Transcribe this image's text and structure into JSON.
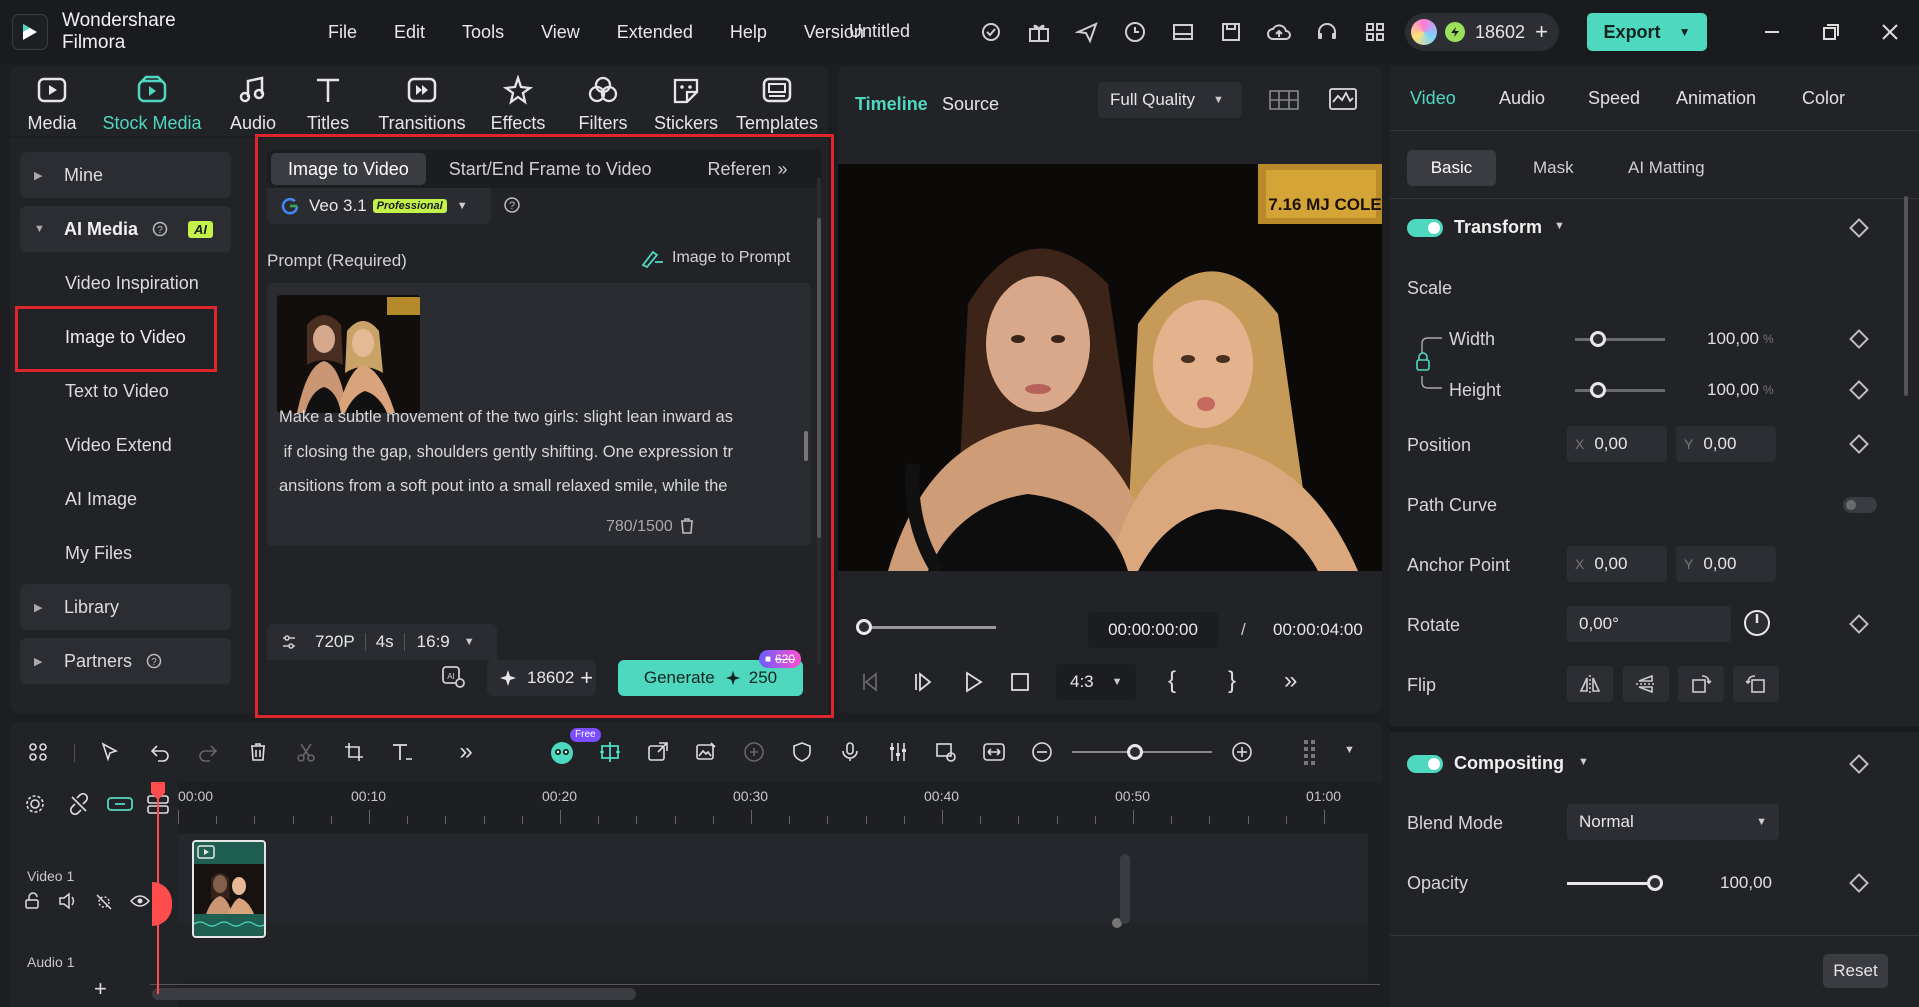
{
  "app": {
    "name": "Wondershare Filmora",
    "project_title": "Untitled",
    "menu": [
      "File",
      "Edit",
      "Tools",
      "View",
      "Extended",
      "Help",
      "Version"
    ],
    "credits": "18602",
    "export_label": "Export"
  },
  "toolbar": {
    "items": [
      {
        "label": "Media",
        "icon": "media-icon"
      },
      {
        "label": "Stock Media",
        "icon": "stock-media-icon",
        "active": true
      },
      {
        "label": "Audio",
        "icon": "audio-icon"
      },
      {
        "label": "Titles",
        "icon": "titles-icon"
      },
      {
        "label": "Transitions",
        "icon": "transitions-icon"
      },
      {
        "label": "Effects",
        "icon": "effects-icon"
      },
      {
        "label": "Filters",
        "icon": "filters-icon"
      },
      {
        "label": "Stickers",
        "icon": "stickers-icon"
      },
      {
        "label": "Templates",
        "icon": "templates-icon"
      }
    ]
  },
  "leftnav": {
    "mine": "Mine",
    "ai_media": "AI Media",
    "ai_badge": "AI",
    "items": [
      "Video Inspiration",
      "Image to Video",
      "Text to Video",
      "Video Extend",
      "AI Image",
      "My Files"
    ],
    "library": "Library",
    "partners": "Partners"
  },
  "ai_panel": {
    "tabs": [
      "Image to Video",
      "Start/End Frame to Video",
      "Referen"
    ],
    "model": "Veo 3.1",
    "model_badge": "Professional",
    "prompt_label": "Prompt (Required)",
    "image_to_prompt": "Image to Prompt",
    "prompt_lines": [
      "Make a subtle movement of the two girls: slight lean inward as",
      " if closing the gap, shoulders gently shifting. One expression tr",
      "ansitions from a soft pout into a small relaxed smile, while the"
    ],
    "char_count": "780/1500",
    "resolution": "720P",
    "duration": "4s",
    "aspect": "16:9",
    "credits": "18602",
    "generate_label": "Generate",
    "generate_cost": "250",
    "generate_badge": "620"
  },
  "preview": {
    "tabs": [
      "Timeline",
      "Source"
    ],
    "quality": "Full Quality",
    "sign_text": "7.16 MJ COLE",
    "time_current": "00:00:00:00",
    "time_sep": "/",
    "time_total": "00:00:04:00",
    "ratio": "4:3",
    "progress": 0
  },
  "props": {
    "tabs": [
      "Video",
      "Audio",
      "Speed",
      "Animation",
      "Color"
    ],
    "subtabs": [
      "Basic",
      "Mask",
      "AI Matting"
    ],
    "transform": "Transform",
    "scale": "Scale",
    "width_label": "Width",
    "width_value": "100,00",
    "height_label": "Height",
    "height_value": "100,00",
    "percent": "%",
    "position": "Position",
    "pos_x": "0,00",
    "pos_y": "0,00",
    "x_label": "X",
    "y_label": "Y",
    "path_curve": "Path Curve",
    "anchor": "Anchor Point",
    "anchor_x": "0,00",
    "anchor_y": "0,00",
    "rotate": "Rotate",
    "rotate_value": "0,00°",
    "flip": "Flip",
    "compositing": "Compositing",
    "blend_mode": "Blend Mode",
    "blend_value": "Normal",
    "opacity": "Opacity",
    "opacity_value": "100,00",
    "reset": "Reset"
  },
  "timeline": {
    "free_badge": "Free",
    "timecodes": [
      "00:00",
      "00:10",
      "00:20",
      "00:30",
      "00:40",
      "00:50",
      "01:00"
    ],
    "video_track": "Video 1",
    "audio_track": "Audio 1",
    "zoom_level": 0.45
  },
  "colors": {
    "accent": "#4fd8c0",
    "highlight_box": "#e0262d",
    "playhead": "#ff4d4d"
  }
}
